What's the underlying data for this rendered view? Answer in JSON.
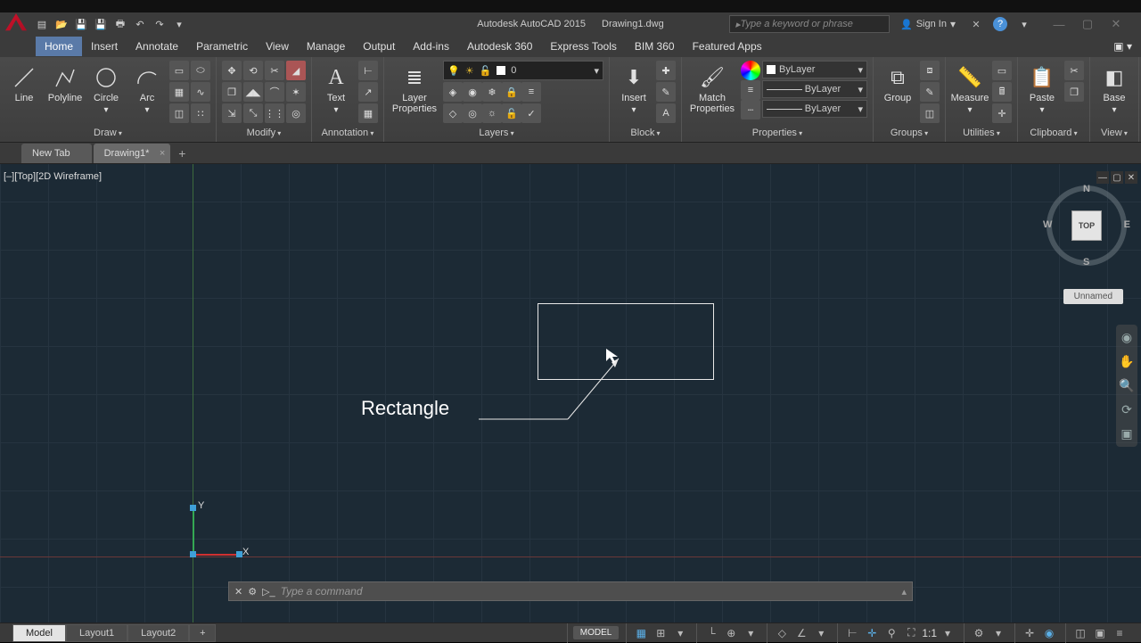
{
  "app": {
    "title": "Autodesk AutoCAD 2015",
    "document": "Drawing1.dwg"
  },
  "search": {
    "placeholder": "Type a keyword or phrase"
  },
  "signin": {
    "label": "Sign In"
  },
  "menuTabs": [
    "Home",
    "Insert",
    "Annotate",
    "Parametric",
    "View",
    "Manage",
    "Output",
    "Add-ins",
    "Autodesk 360",
    "Express Tools",
    "BIM 360",
    "Featured Apps"
  ],
  "ribbon": {
    "draw": {
      "title": "Draw",
      "line": "Line",
      "polyline": "Polyline",
      "circle": "Circle",
      "arc": "Arc"
    },
    "modify": {
      "title": "Modify"
    },
    "annotation": {
      "title": "Annotation",
      "text": "Text"
    },
    "layers": {
      "title": "Layers",
      "layerprops": "Layer\nProperties",
      "current": "0"
    },
    "block": {
      "title": "Block",
      "insert": "Insert"
    },
    "properties": {
      "title": "Properties",
      "match": "Match\nProperties",
      "bylayer": "ByLayer"
    },
    "groups": {
      "title": "Groups",
      "group": "Group"
    },
    "utilities": {
      "title": "Utilities",
      "measure": "Measure"
    },
    "clipboard": {
      "title": "Clipboard",
      "paste": "Paste"
    },
    "view": {
      "title": "View",
      "base": "Base"
    }
  },
  "fileTabs": {
    "new": "New Tab",
    "drawing": "Drawing1*"
  },
  "viewport": {
    "label": "[–][Top][2D Wireframe]"
  },
  "viewcube": {
    "face": "TOP",
    "n": "N",
    "s": "S",
    "e": "E",
    "w": "W",
    "unnamed": "Unnamed"
  },
  "annotation": {
    "label": "Rectangle"
  },
  "ucs": {
    "x": "X",
    "y": "Y"
  },
  "cmd": {
    "placeholder": "Type a command"
  },
  "layouts": {
    "model": "Model",
    "l1": "Layout1",
    "l2": "Layout2"
  },
  "status": {
    "model": "MODEL",
    "scale": "1:1"
  }
}
